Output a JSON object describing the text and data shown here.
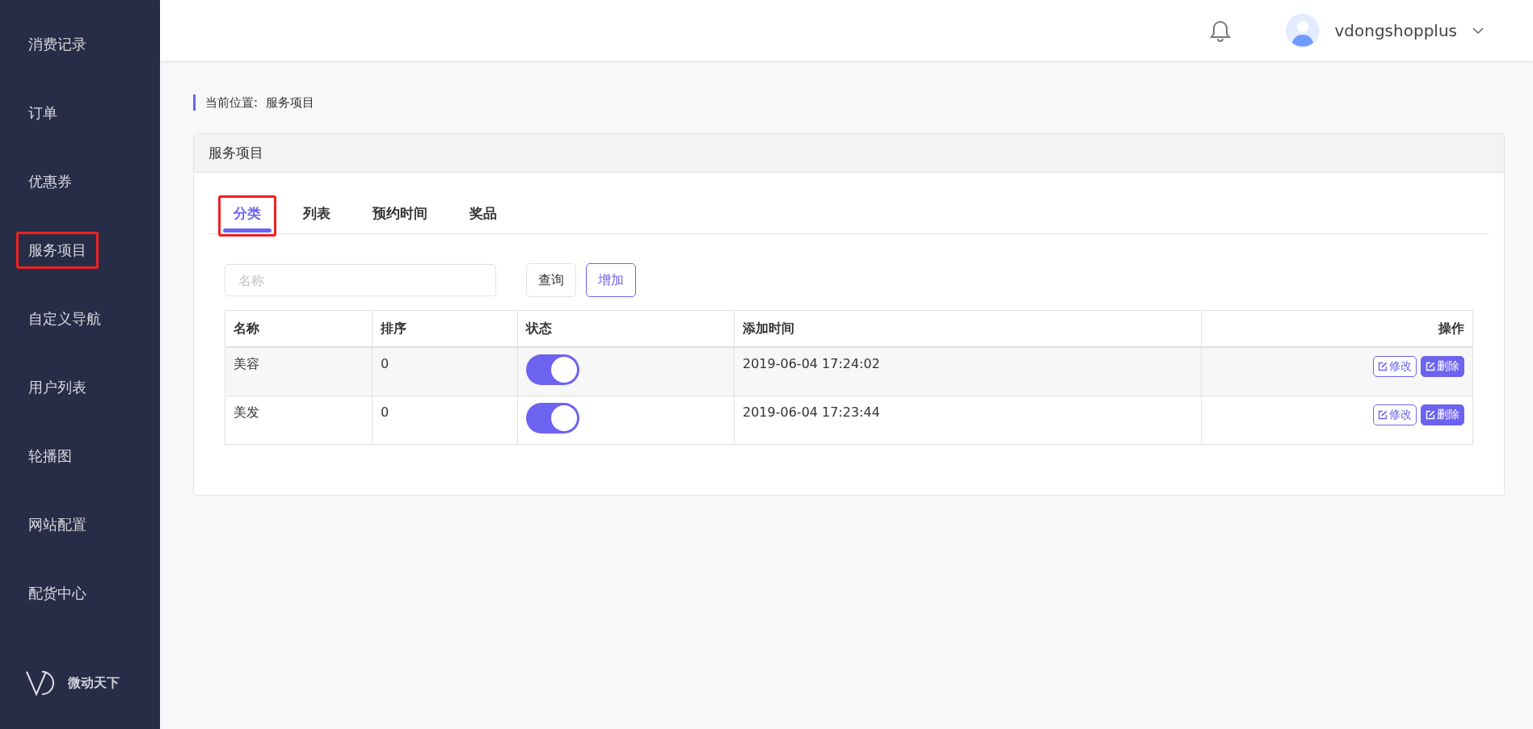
{
  "sidebar": {
    "items": [
      {
        "label": "消费记录",
        "annotated": false
      },
      {
        "label": "订单",
        "annotated": false
      },
      {
        "label": "优惠券",
        "annotated": false
      },
      {
        "label": "服务项目",
        "annotated": true
      },
      {
        "label": "自定义导航",
        "annotated": false
      },
      {
        "label": "用户列表",
        "annotated": false
      },
      {
        "label": "轮播图",
        "annotated": false
      },
      {
        "label": "网站配置",
        "annotated": false
      },
      {
        "label": "配货中心",
        "annotated": false
      }
    ],
    "brand": "微动天下"
  },
  "header": {
    "username": "vdongshopplus"
  },
  "breadcrumb": {
    "label": "当前位置:",
    "current": "服务项目"
  },
  "panel": {
    "title": "服务项目",
    "tabs": [
      {
        "label": "分类",
        "selected": true,
        "annotated": true
      },
      {
        "label": "列表",
        "selected": false,
        "annotated": false
      },
      {
        "label": "预约时间",
        "selected": false,
        "annotated": false
      },
      {
        "label": "奖品",
        "selected": false,
        "annotated": false
      }
    ],
    "search": {
      "placeholder": "名称"
    },
    "buttons": [
      {
        "label": "查询",
        "kind": "plain"
      },
      {
        "label": "增加",
        "kind": "outline"
      }
    ],
    "table": {
      "columns": [
        "名称",
        "排序",
        "状态",
        "添加时间",
        "操作"
      ],
      "rows": [
        {
          "name": "美容",
          "order": "0",
          "on": true,
          "time": "2019-06-04 17:24:02",
          "actions": [
            {
              "label": "修改",
              "kind": "outline"
            },
            {
              "label": "删除",
              "kind": "solid"
            }
          ]
        },
        {
          "name": "美发",
          "order": "0",
          "on": true,
          "time": "2019-06-04 17:23:44",
          "actions": [
            {
              "label": "修改",
              "kind": "outline"
            },
            {
              "label": "删除",
              "kind": "solid"
            }
          ]
        }
      ]
    }
  }
}
